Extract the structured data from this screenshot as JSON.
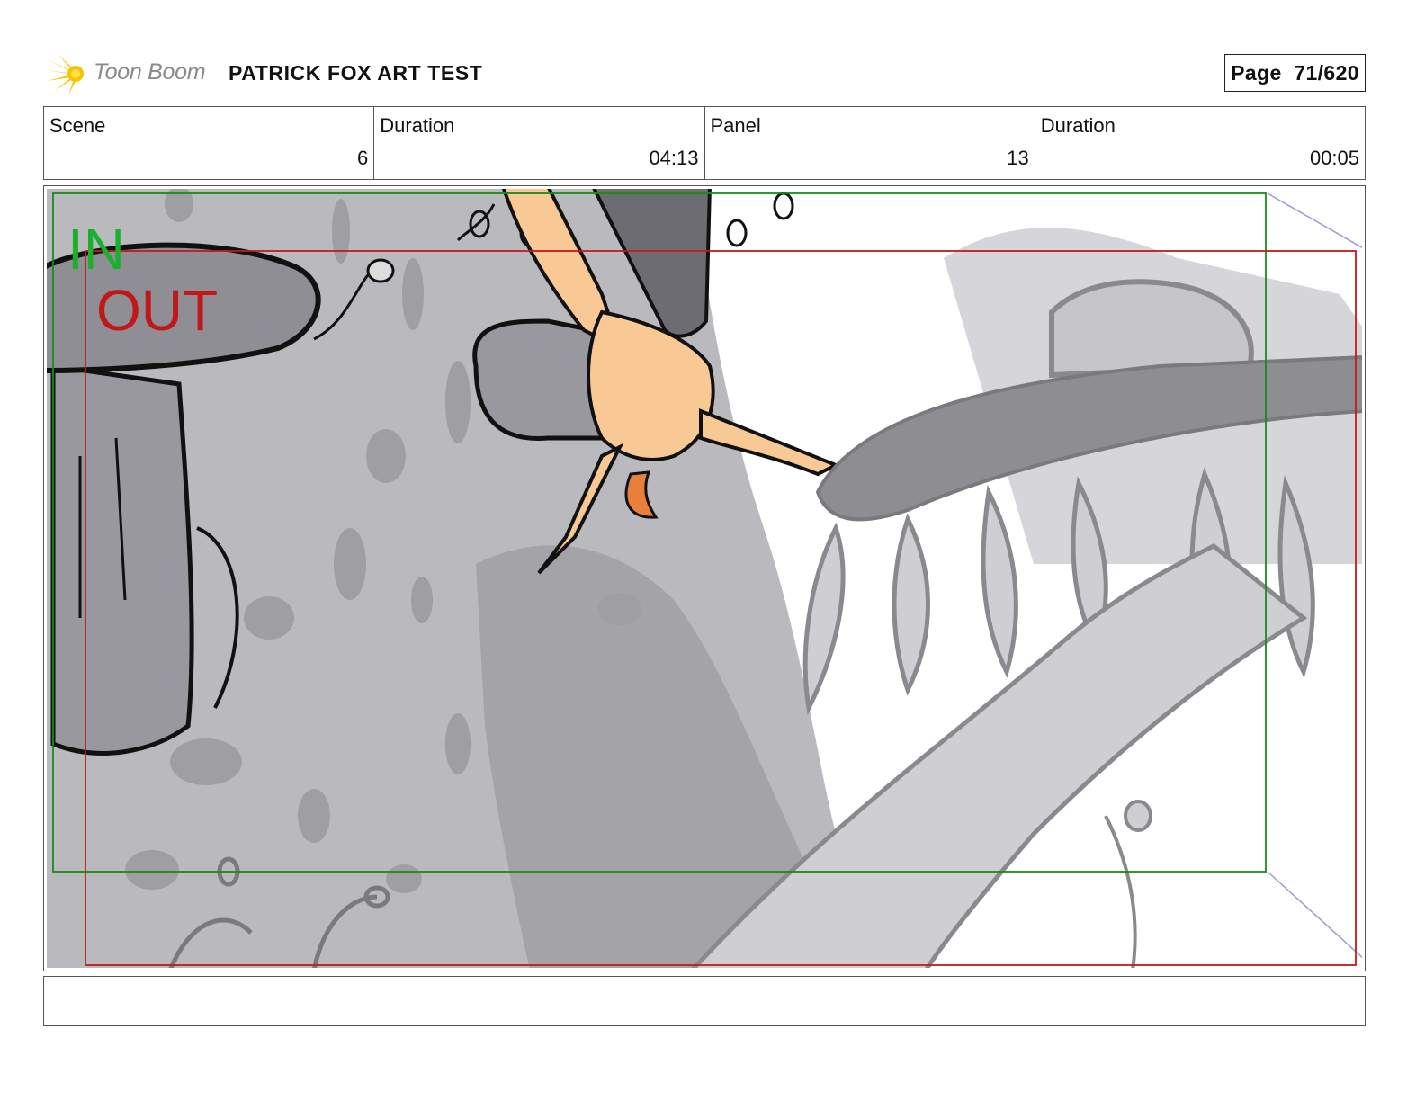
{
  "header": {
    "logo_text": "Toon Boom",
    "project_title": "PATRICK FOX ART TEST",
    "page_label": "Page",
    "page_number": "71/620"
  },
  "info": {
    "scene_label": "Scene",
    "scene_value": "6",
    "scene_duration_label": "Duration",
    "scene_duration_value": "04:13",
    "panel_label": "Panel",
    "panel_value": "13",
    "panel_duration_label": "Duration",
    "panel_duration_value": "00:05"
  },
  "panel": {
    "in_label": "IN",
    "out_label": "OUT",
    "in_color": "#18b02c",
    "out_color": "#c01818"
  },
  "notes": {
    "text": ""
  }
}
